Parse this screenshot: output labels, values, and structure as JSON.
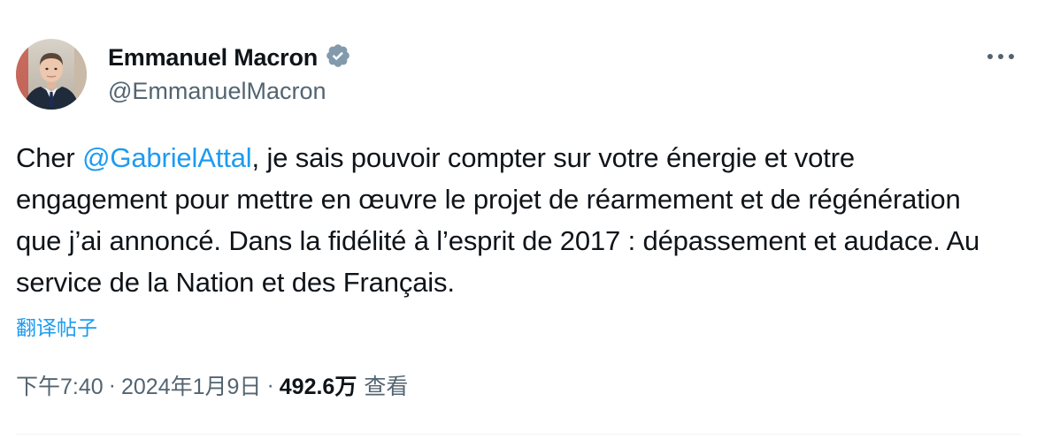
{
  "author": {
    "display_name": "Emmanuel Macron",
    "handle": "@EmmanuelMacron",
    "verified_icon": "verified-badge-icon",
    "verified_color": "#829aab"
  },
  "more_icon": "more-horizontal-icon",
  "tweet": {
    "text_before": "Cher ",
    "mention": "@GabrielAttal",
    "text_after": ", je sais pouvoir compter sur votre énergie et votre engagement pour mettre en œuvre le projet de réarmement et de régénération que j’ai annoncé. Dans la fidélité à l’esprit de 2017 : dépassement et audace. Au service de la Nation et des Français."
  },
  "translate_label": "翻译帖子",
  "meta": {
    "time": "下午7:40",
    "separator": "·",
    "date": "2024年1月9日",
    "views_count": "492.6万",
    "views_label": "查看"
  },
  "colors": {
    "link": "#1d9bf0",
    "secondary_text": "#536471",
    "primary_text": "#0f1419",
    "divider": "#eff3f4"
  }
}
